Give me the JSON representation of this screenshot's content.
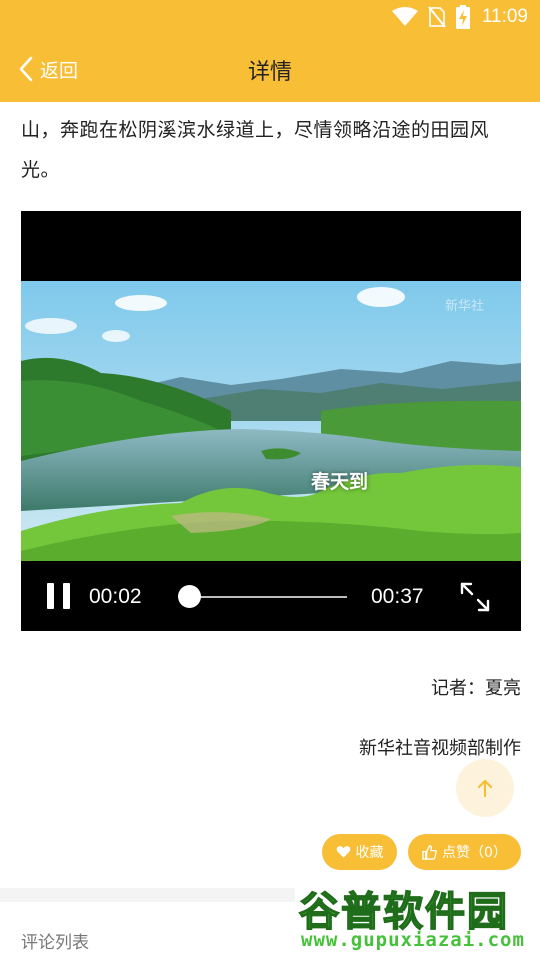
{
  "status_bar": {
    "time": "11:09",
    "icons": [
      "wifi-icon",
      "no-sim-icon",
      "battery-charging-icon"
    ]
  },
  "header": {
    "back_label": "返回",
    "title": "详情"
  },
  "article": {
    "text": "山，奔跑在松阴溪滨水绿道上，尽情领略沿途的田园风光。"
  },
  "video": {
    "caption": "春天到",
    "corner_mark": "新华社",
    "current_time": "00:02",
    "total_time": "00:37",
    "progress": 0.054
  },
  "credits": {
    "reporter": "记者：夏亮",
    "producer": "新华社音视频部制作"
  },
  "actions": {
    "favorite_label": "收藏",
    "like_label": "点赞（0）"
  },
  "comments": {
    "title": "评论列表"
  },
  "site_watermark": {
    "name": "谷普软件园",
    "url": "www.gupuxiazai.com"
  },
  "colors": {
    "accent": "#f8be35",
    "to_top_bg": "#fdf3dc"
  }
}
